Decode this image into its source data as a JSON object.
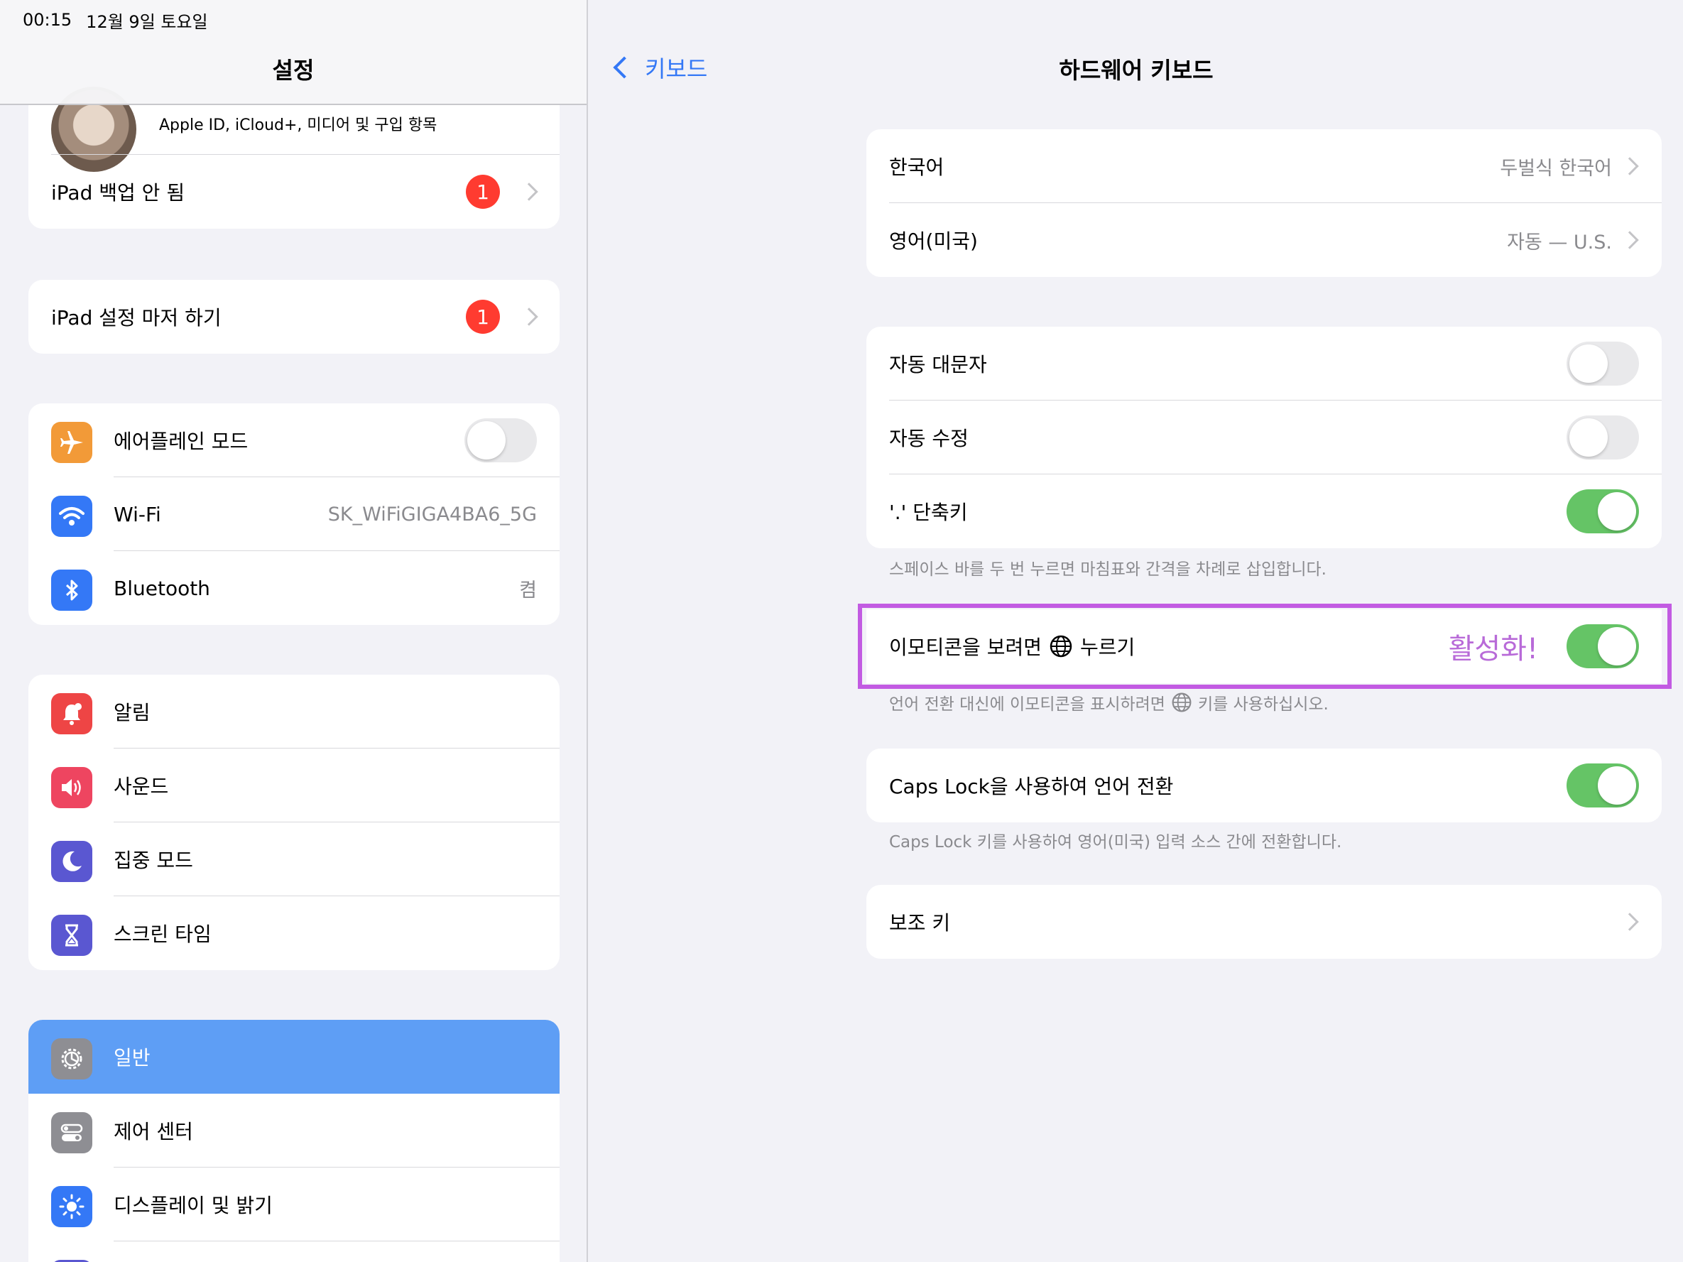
{
  "status": {
    "time": "00:15",
    "date": "12월 9일 토요일"
  },
  "sidebar": {
    "title": "설정",
    "profile": {
      "subtitle": "Apple ID, iCloud+, 미디어 및 구입 항목"
    },
    "backup": {
      "label": "iPad 백업 안 됨",
      "badge": "1"
    },
    "finish_setup": {
      "label": "iPad 설정 마저 하기",
      "badge": "1"
    },
    "connectivity": [
      {
        "label": "에어플레인 모드",
        "icon": "airplane-icon",
        "color": "#f29a38",
        "toggle": false
      },
      {
        "label": "Wi-Fi",
        "icon": "wifi-icon",
        "color": "#3478f6",
        "value": "SK_WiFiGIGA4BA6_5G"
      },
      {
        "label": "Bluetooth",
        "icon": "bluetooth-icon",
        "color": "#3478f6",
        "value": "켬"
      }
    ],
    "notifications": [
      {
        "label": "알림",
        "icon": "bell-icon",
        "color": "#ee4545"
      },
      {
        "label": "사운드",
        "icon": "speaker-icon",
        "color": "#ee4560"
      },
      {
        "label": "집중 모드",
        "icon": "moon-icon",
        "color": "#5a57d1"
      },
      {
        "label": "스크린 타임",
        "icon": "hourglass-icon",
        "color": "#5a57d1"
      }
    ],
    "general": [
      {
        "label": "일반",
        "icon": "gear-icon",
        "color": "#8e8e93",
        "selected": true
      },
      {
        "label": "제어 센터",
        "icon": "switches-icon",
        "color": "#8e8e93"
      },
      {
        "label": "디스플레이 및 밝기",
        "icon": "sun-icon",
        "color": "#3478f6"
      }
    ]
  },
  "detail": {
    "back_label": "키보드",
    "title": "하드웨어 키보드",
    "languages": [
      {
        "label": "한국어",
        "value": "두벌식 한국어"
      },
      {
        "label": "영어(미국)",
        "value": "자동 — U.S."
      }
    ],
    "options": [
      {
        "label": "자동 대문자",
        "toggle": false
      },
      {
        "label": "자동 수정",
        "toggle": false
      },
      {
        "label": "'.' 단축키",
        "toggle": true
      }
    ],
    "options_footnote": "스페이스 바를 두 번 누르면 마침표와 간격을 차례로 삽입합니다.",
    "emoji": {
      "label_before": "이모티콘을 보려면",
      "label_after": "누르기",
      "annotation": "활성화!",
      "toggle": true,
      "footnote_before": "언어 전환 대신에 이모티콘을 표시하려면",
      "footnote_after": "키를 사용하십시오."
    },
    "capslock": {
      "label": "Caps Lock을 사용하여 언어 전환",
      "toggle": true,
      "footnote": "Caps Lock 키를 사용하여 영어(미국) 입력 소스 간에 전환합니다."
    },
    "modifier": {
      "label": "보조 키"
    }
  },
  "colors": {
    "accent": "#3478f6",
    "toggle_on": "#65c466",
    "highlight": "#c25be2",
    "badge": "#ff3b30",
    "selected_row": "#5e9ef5"
  }
}
